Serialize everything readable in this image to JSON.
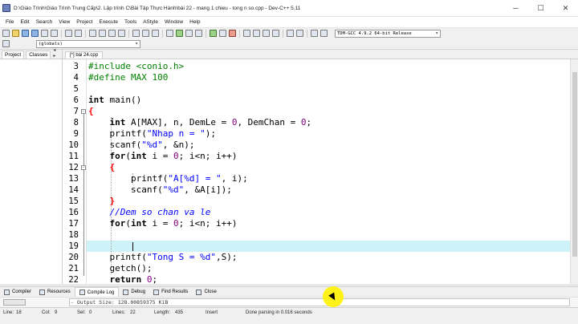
{
  "window": {
    "title": "D:\\Giáo Trình\\Giáo Trình Trung Cấp\\2. Lập trình C\\Bài Tập Thực Hành\\bài 22 - mang 1 chieu - tong n so.cpp - Dev-C++ 5.11",
    "min_glyph": "─",
    "max_glyph": "☐",
    "close_glyph": "✕"
  },
  "menu": [
    "File",
    "Edit",
    "Search",
    "View",
    "Project",
    "Execute",
    "Tools",
    "AStyle",
    "Window",
    "Help"
  ],
  "toolbar": {
    "compiler": "TDM-GCC 4.9.2 64-bit Release",
    "scope": "(globals)"
  },
  "left_panel": {
    "tabs": [
      "Project",
      "Classes"
    ],
    "nav": "◂ ▸"
  },
  "editor": {
    "tab_label": "[*] bài 24.cpp",
    "line_numbers": [
      "3",
      "4",
      "5",
      "6",
      "7",
      "8",
      "9",
      "10",
      "11",
      "12",
      "13",
      "14",
      "15",
      "16",
      "17",
      "18",
      "19",
      "20",
      "21",
      "22"
    ],
    "lines": {
      "l3": "#include <conio.h>",
      "l4": "#define MAX 100",
      "l6a": "int",
      "l6b": " main()",
      "l7": "{",
      "l8a": "    int",
      "l8b": " A[MAX], n, DemLe = ",
      "l8c": "0",
      "l8d": ", DemChan = ",
      "l8e": "0",
      "l8f": ";",
      "l9a": "    printf(",
      "l9b": "\"Nhap n = \"",
      "l9c": ");",
      "l10a": "    scanf(",
      "l10b": "\"%d\"",
      "l10c": ", &n);",
      "l11a": "    for",
      "l11b": "(",
      "l11c": "int",
      "l11d": " i = ",
      "l11e": "0",
      "l11f": "; i<n; i++)",
      "l12": "    {",
      "l13a": "        printf(",
      "l13b": "\"A[%d] = \"",
      "l13c": ", i);",
      "l14a": "        scanf(",
      "l14b": "\"%d\"",
      "l14c": ", &A[i]);",
      "l15": "    }",
      "l16": "    //Dem so chan va le",
      "l17a": "    for",
      "l17b": "(",
      "l17c": "int",
      "l17d": " i = ",
      "l17e": "0",
      "l17f": "; i<n; i++)",
      "l18": "",
      "l19a": "    printf(",
      "l19b": "\"Tong S = %d\"",
      "l19c": ",S);",
      "l20": "    getch();",
      "l21a": "    return ",
      "l21b": "0",
      "l21c": ";",
      "l22": "}"
    }
  },
  "bottom_tabs": [
    "Compiler",
    "Resources",
    "Compile Log",
    "Debug",
    "Find Results",
    "Close"
  ],
  "output": {
    "size_text": "- Output Size: 128.00859375 KiB"
  },
  "status": {
    "line_label": "Line:",
    "line_value": "18",
    "col_label": "Col:",
    "col_value": "9",
    "sel_label": "Sel:",
    "sel_value": "0",
    "lines_label": "Lines:",
    "lines_value": "22",
    "length_label": "Length:",
    "length_value": "435",
    "mode": "Insert",
    "message": "Done parsing in 0.016 seconds"
  }
}
